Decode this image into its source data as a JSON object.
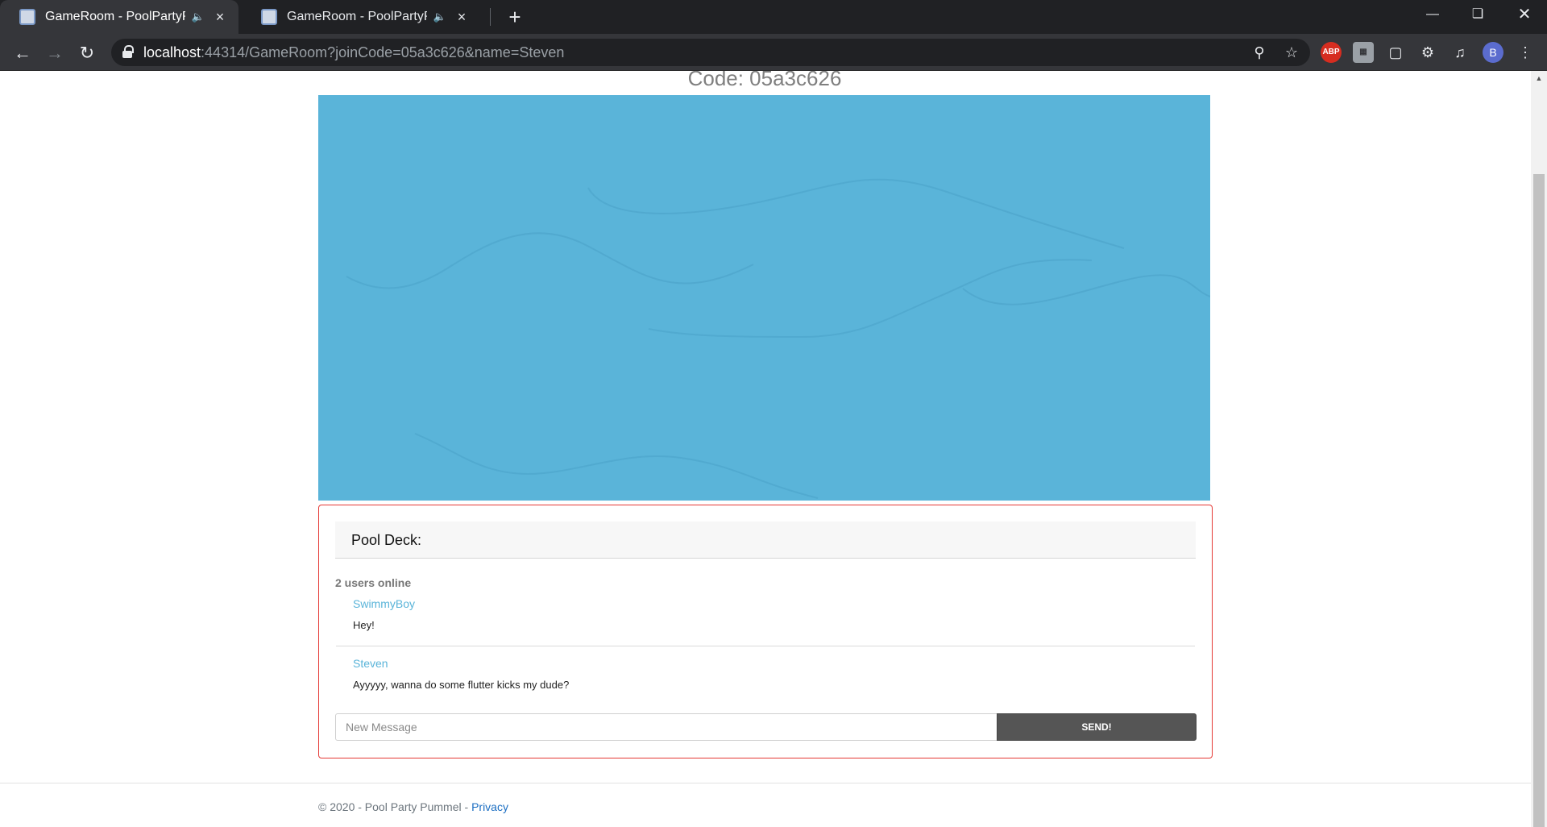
{
  "browser": {
    "tabs": [
      {
        "title": "GameRoom - PoolPartyPummel",
        "active": true
      },
      {
        "title": "GameRoom - PoolPartyPummel",
        "active": false
      }
    ],
    "address": {
      "host": "localhost",
      "rest": ":44314/GameRoom?joinCode=05a3c626&name=Steven"
    },
    "avatar_letter": "B",
    "ext_abp": "ABP"
  },
  "page": {
    "code_title": "Code: 05a3c626",
    "pool_color": "#5ab4d9",
    "deck": {
      "title": "Pool Deck:",
      "users_online": "2 users online",
      "messages": [
        {
          "sender": "SwimmyBoy",
          "text": "Hey!"
        },
        {
          "sender": "Steven",
          "text": "Ayyyyy, wanna do some flutter kicks my dude?"
        }
      ],
      "input_placeholder": "New Message",
      "send_label": "SEND!"
    },
    "footer": {
      "copyright": "© 2020 - Pool Party Pummel - ",
      "privacy_link": "Privacy"
    }
  }
}
